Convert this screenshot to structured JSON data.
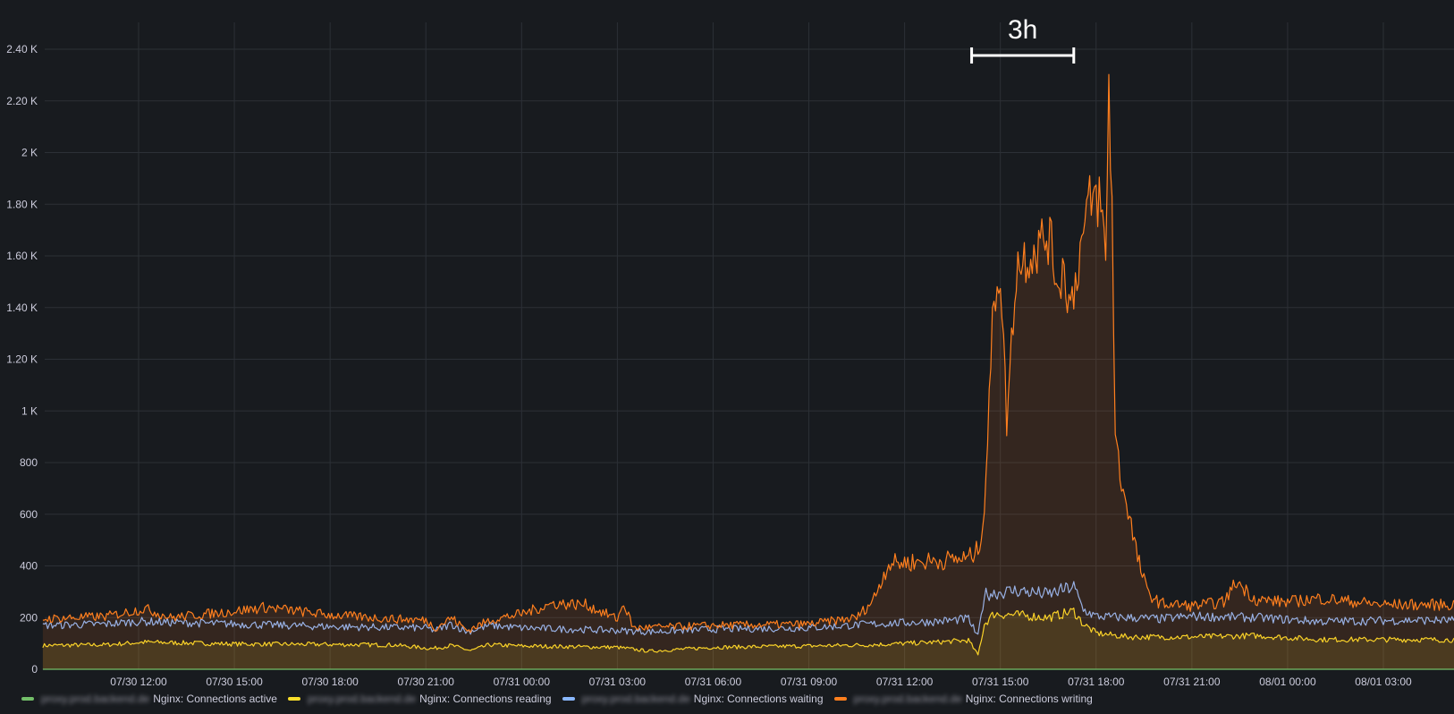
{
  "annotation": {
    "text": "3h"
  },
  "chart_data": {
    "type": "area",
    "title": "",
    "xlabel": "",
    "ylabel": "",
    "ylim": [
      0,
      2500
    ],
    "x_range_hours": [
      0,
      48
    ],
    "y_ticks": [
      {
        "value": 0,
        "label": "0"
      },
      {
        "value": 200,
        "label": "200"
      },
      {
        "value": 400,
        "label": "400"
      },
      {
        "value": 600,
        "label": "600"
      },
      {
        "value": 800,
        "label": "800"
      },
      {
        "value": 1000,
        "label": "1 K"
      },
      {
        "value": 1200,
        "label": "1.20 K"
      },
      {
        "value": 1400,
        "label": "1.40 K"
      },
      {
        "value": 1600,
        "label": "1.60 K"
      },
      {
        "value": 1800,
        "label": "1.80 K"
      },
      {
        "value": 2000,
        "label": "2 K"
      },
      {
        "value": 2200,
        "label": "2.20 K"
      },
      {
        "value": 2400,
        "label": "2.40 K"
      }
    ],
    "x_ticks": [
      {
        "hour": 3,
        "label": "07/30 12:00"
      },
      {
        "hour": 6,
        "label": "07/30 15:00"
      },
      {
        "hour": 9,
        "label": "07/30 18:00"
      },
      {
        "hour": 12,
        "label": "07/30 21:00"
      },
      {
        "hour": 15,
        "label": "07/31 00:00"
      },
      {
        "hour": 18,
        "label": "07/31 03:00"
      },
      {
        "hour": 21,
        "label": "07/31 06:00"
      },
      {
        "hour": 24,
        "label": "07/31 09:00"
      },
      {
        "hour": 27,
        "label": "07/31 12:00"
      },
      {
        "hour": 30,
        "label": "07/31 15:00"
      },
      {
        "hour": 33,
        "label": "07/31 18:00"
      },
      {
        "hour": 36,
        "label": "07/31 21:00"
      },
      {
        "hour": 39,
        "label": "08/01 00:00"
      },
      {
        "hour": 42,
        "label": "08/01 03:00"
      }
    ],
    "annotation_span_hours": [
      29.1,
      32.3
    ],
    "grid": true,
    "legend_placement": "bottom-left",
    "series": [
      {
        "name": "Nginx: Connections active",
        "host": "proxy.prod.backend.de",
        "color": "#73bf69",
        "fill": false,
        "points": [
          [
            0,
            0
          ],
          [
            48,
            0
          ]
        ]
      },
      {
        "name": "Nginx: Connections reading",
        "host": "proxy.prod.backend.de",
        "color": "#fade2a",
        "fill": true,
        "points": [
          [
            0,
            92
          ],
          [
            2,
            95
          ],
          [
            3.2,
            105
          ],
          [
            6,
            98
          ],
          [
            9,
            96
          ],
          [
            11,
            94
          ],
          [
            12.2,
            80
          ],
          [
            12.8,
            92
          ],
          [
            13.4,
            72
          ],
          [
            14,
            95
          ],
          [
            15,
            90
          ],
          [
            18,
            85
          ],
          [
            19,
            70
          ],
          [
            21,
            85
          ],
          [
            24,
            90
          ],
          [
            26,
            95
          ],
          [
            28,
            105
          ],
          [
            29,
            112
          ],
          [
            29.3,
            55
          ],
          [
            29.5,
            175
          ],
          [
            29.8,
            215
          ],
          [
            30.5,
            210
          ],
          [
            31.5,
            200
          ],
          [
            32.3,
            225
          ],
          [
            32.6,
            175
          ],
          [
            33,
            140
          ],
          [
            34,
            125
          ],
          [
            36,
            125
          ],
          [
            38,
            130
          ],
          [
            40,
            115
          ],
          [
            43,
            115
          ],
          [
            48,
            110
          ]
        ]
      },
      {
        "name": "Nginx: Connections waiting",
        "host": "proxy.prod.backend.de",
        "color": "#8ab8ff",
        "fill": false,
        "points": [
          [
            0,
            170
          ],
          [
            2,
            175
          ],
          [
            3,
            185
          ],
          [
            6,
            175
          ],
          [
            9,
            165
          ],
          [
            12,
            160
          ],
          [
            12.3,
            150
          ],
          [
            12.8,
            175
          ],
          [
            13.3,
            145
          ],
          [
            14,
            170
          ],
          [
            15,
            160
          ],
          [
            18,
            150
          ],
          [
            19,
            145
          ],
          [
            21,
            155
          ],
          [
            24,
            160
          ],
          [
            26,
            175
          ],
          [
            28,
            185
          ],
          [
            29,
            195
          ],
          [
            29.3,
            125
          ],
          [
            29.5,
            290
          ],
          [
            30.5,
            305
          ],
          [
            31.5,
            290
          ],
          [
            32.3,
            320
          ],
          [
            32.6,
            230
          ],
          [
            33,
            205
          ],
          [
            35,
            195
          ],
          [
            36,
            205
          ],
          [
            38,
            200
          ],
          [
            40,
            185
          ],
          [
            43,
            190
          ],
          [
            48,
            185
          ]
        ]
      },
      {
        "name": "Nginx: Connections writing",
        "host": "proxy.prod.backend.de",
        "color": "#ff7f1e",
        "fill": true,
        "points": [
          [
            0,
            195
          ],
          [
            2,
            205
          ],
          [
            3.2,
            235
          ],
          [
            4,
            200
          ],
          [
            6,
            225
          ],
          [
            7,
            240
          ],
          [
            9,
            210
          ],
          [
            11,
            195
          ],
          [
            12,
            190
          ],
          [
            12.3,
            160
          ],
          [
            12.8,
            200
          ],
          [
            13.3,
            150
          ],
          [
            14,
            190
          ],
          [
            15,
            215
          ],
          [
            16,
            255
          ],
          [
            17,
            250
          ],
          [
            18,
            195
          ],
          [
            18.2,
            255
          ],
          [
            18.5,
            160
          ],
          [
            21,
            170
          ],
          [
            24,
            175
          ],
          [
            25.5,
            200
          ],
          [
            26,
            265
          ],
          [
            26.5,
            410
          ],
          [
            28,
            420
          ],
          [
            29,
            430
          ],
          [
            29.3,
            460
          ],
          [
            29.5,
            620
          ],
          [
            29.8,
            1450
          ],
          [
            30,
            1550
          ],
          [
            30.2,
            960
          ],
          [
            30.5,
            1560
          ],
          [
            30.8,
            1600
          ],
          [
            31.2,
            1640
          ],
          [
            31.5,
            1680
          ],
          [
            31.8,
            1500
          ],
          [
            32,
            1550
          ],
          [
            32.2,
            1400
          ],
          [
            32.5,
            1620
          ],
          [
            32.8,
            1800
          ],
          [
            33.1,
            1830
          ],
          [
            33.3,
            1600
          ],
          [
            33.4,
            2250
          ],
          [
            33.5,
            1800
          ],
          [
            33.6,
            900
          ],
          [
            33.8,
            720
          ],
          [
            34,
            620
          ],
          [
            34.3,
            430
          ],
          [
            34.6,
            300
          ],
          [
            35,
            255
          ],
          [
            36,
            245
          ],
          [
            37,
            260
          ],
          [
            37.4,
            340
          ],
          [
            38,
            270
          ],
          [
            39,
            260
          ],
          [
            40,
            275
          ],
          [
            42,
            250
          ],
          [
            44,
            250
          ],
          [
            48,
            250
          ]
        ]
      }
    ]
  }
}
